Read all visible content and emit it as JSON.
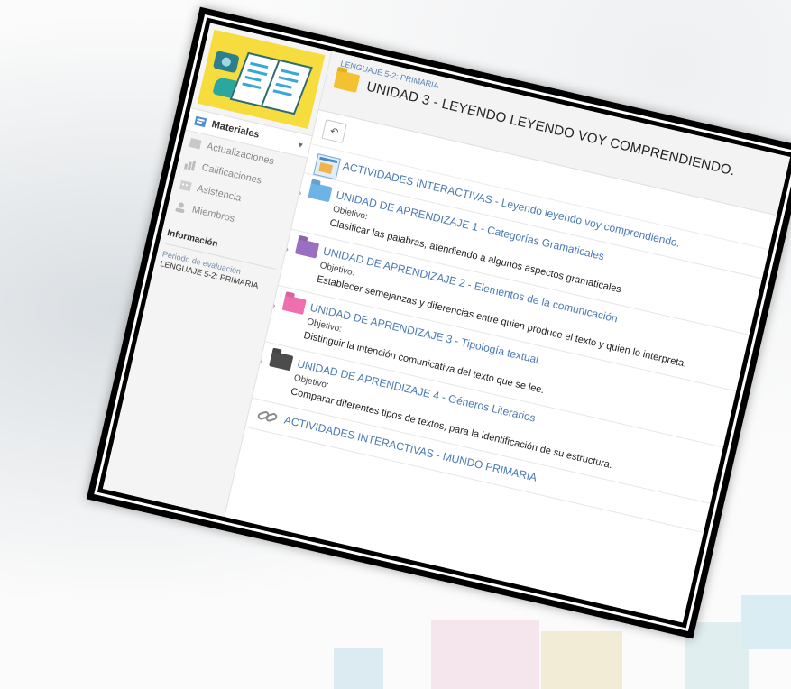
{
  "colors": {
    "link": "#4a78b3",
    "course_image_bg": "#f6dc3c",
    "folder_blue": "#6cb4e6",
    "folder_purple": "#9a6ec2",
    "folder_pink": "#ef6fae",
    "folder_dark": "#4c4c4c",
    "folder_yellow": "#f2c230"
  },
  "sidebar": {
    "items": [
      {
        "label": "Materiales",
        "icon": "materials-icon",
        "active": true
      },
      {
        "label": "Actualizaciones",
        "icon": "updates-icon",
        "active": false
      },
      {
        "label": "Calificaciones",
        "icon": "grades-icon",
        "active": false
      },
      {
        "label": "Asistencia",
        "icon": "attendance-icon",
        "active": false
      },
      {
        "label": "Miembros",
        "icon": "members-icon",
        "active": false
      }
    ],
    "info_heading": "Información",
    "period_label": "Periodo de evaluación",
    "period_value": "LENGUAJE 5-2: PRIMARIA"
  },
  "header": {
    "breadcrumb": "LENGUAJE 5-2: PRIMARIA",
    "title": "UNIDAD 3 - LEYENDO LEYENDO VOY COMPRENDIENDO."
  },
  "toolbar": {
    "back_icon": "back-arrow-icon"
  },
  "items": [
    {
      "title": "ACTIVIDADES INTERACTIVAS - Leyendo leyendo voy comprendiendo.",
      "icon": "web-page-icon"
    },
    {
      "title": "UNIDAD DE APRENDIZAJE 1 - Categorías Gramaticales",
      "objective_label": "Objetivo:",
      "objective": "Clasificar las palabras, atendiendo a algunos aspectos gramaticales",
      "icon": "folder-blue-icon"
    },
    {
      "title": "UNIDAD DE APRENDIZAJE 2 - Elementos de la comunicación",
      "objective_label": "Objetivo:",
      "objective": "Establecer semejanzas y diferencias entre quien produce el texto y quien lo interpreta.",
      "icon": "folder-purple-icon"
    },
    {
      "title": "UNIDAD DE APRENDIZAJE 3 - Tipología textual.",
      "objective_label": "Objetivo:",
      "objective": "Distinguir la intención comunicativa del texto que se lee.",
      "icon": "folder-pink-icon"
    },
    {
      "title": "UNIDAD DE APRENDIZAJE 4 - Géneros Literarios",
      "objective_label": "Objetivo:",
      "objective": "Comparar diferentes tipos de textos, para la identificación de su estructura.",
      "icon": "folder-dark-icon"
    },
    {
      "title": "ACTIVIDADES INTERACTIVAS - MUNDO PRIMARIA",
      "icon": "link-icon"
    }
  ]
}
